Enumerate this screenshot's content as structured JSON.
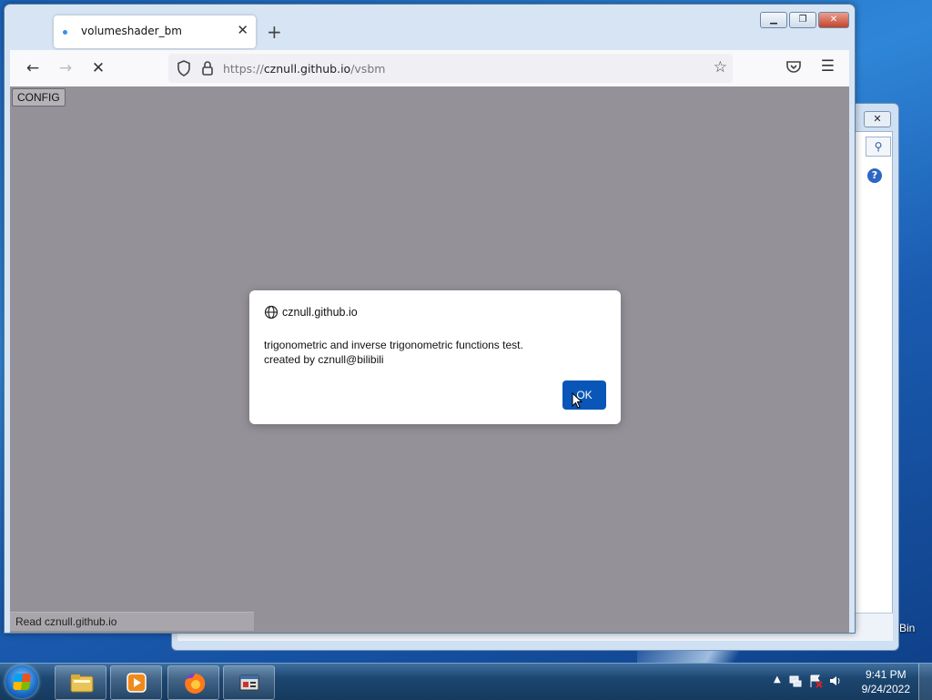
{
  "desktop": {
    "recycle_bin_label": "Bin"
  },
  "browser": {
    "tab": {
      "title": "volumeshader_bm"
    },
    "url": {
      "prefix": "https://",
      "host": "cznull.github.io",
      "path": "/vsbm"
    },
    "page": {
      "config_button": "CONFIG",
      "status_text": "Read cznull.github.io"
    }
  },
  "dialog": {
    "origin": "cznull.github.io",
    "message_line1": "trigonometric and inverse trigonometric functions test.",
    "message_line2": "created by cznull@bilibili",
    "ok_label": "OK"
  },
  "taskbar": {
    "time": "9:41 PM",
    "date": "9/24/2022",
    "pinned": [
      "windows-explorer",
      "media-player",
      "firefox",
      "app-window"
    ]
  },
  "colors": {
    "page_background": "#949198",
    "ok_button": "#0a56b8",
    "taskbar": "#1c4670"
  }
}
